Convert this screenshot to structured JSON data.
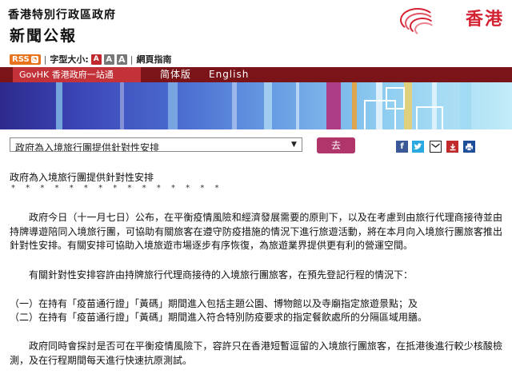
{
  "header": {
    "gov_name": "香港特別行政區政府",
    "press_title": "新聞公報",
    "brand": "香港"
  },
  "toolbar": {
    "rss_label": "RSS",
    "font_size_label": "字型大小:",
    "font_small": "A",
    "font_mid": "A",
    "font_large": "A",
    "web_guide": "網頁指南"
  },
  "nav": {
    "govhk": "GovHK 香港政府一站通",
    "simplified": "简体版",
    "english": "English"
  },
  "search": {
    "selected_topic": "政府為入境旅行團提供針對性安排",
    "go_label": "去"
  },
  "share": {
    "facebook": "facebook-icon",
    "twitter": "twitter-icon",
    "email": "email-icon",
    "whatsapp": "whatsapp-icon",
    "print": "print-icon"
  },
  "colors": {
    "nav_dark": "#7a1418",
    "nav_active": "#c23238",
    "go_button": "#b0356a",
    "brand_red": "#d42233"
  },
  "article": {
    "title": "政府為入境旅行團提供針對性安排",
    "stars": "* * * * * * * * * * * * * * *",
    "p1": "政府今日（十一月七日）公布，在平衡疫情風險和經濟發展需要的原則下，以及在考慮到由旅行代理商接待並由持牌導遊陪同入境旅行團，可協助有關旅客在遵守防疫措施的情況下進行旅遊活動，將在本月向入境旅行團旅客推出針對性安排。有關安排可協助入境旅遊市場逐步有序恢復，為旅遊業界提供更有利的營運空間。",
    "p2": "有關針對性安排容許由持牌旅行代理商接待的入境旅行團旅客，在預先登記行程的情況下：",
    "item1": "（一）在持有「疫苗通行證」「黃碼」期間進入包括主題公園、博物館以及寺廟指定旅遊景點；及",
    "item2": "（二）在持有「疫苗通行證」「黃碼」期間進入符合特別防疫要求的指定餐飲處所的分隔區域用膳。",
    "p3": "政府同時會探討是否可在平衡疫情風險下，容許只在香港短暫逗留的入境旅行團旅客，在抵港後進行較少核酸檢測，及在行程期間每天進行快速抗原測試。"
  }
}
